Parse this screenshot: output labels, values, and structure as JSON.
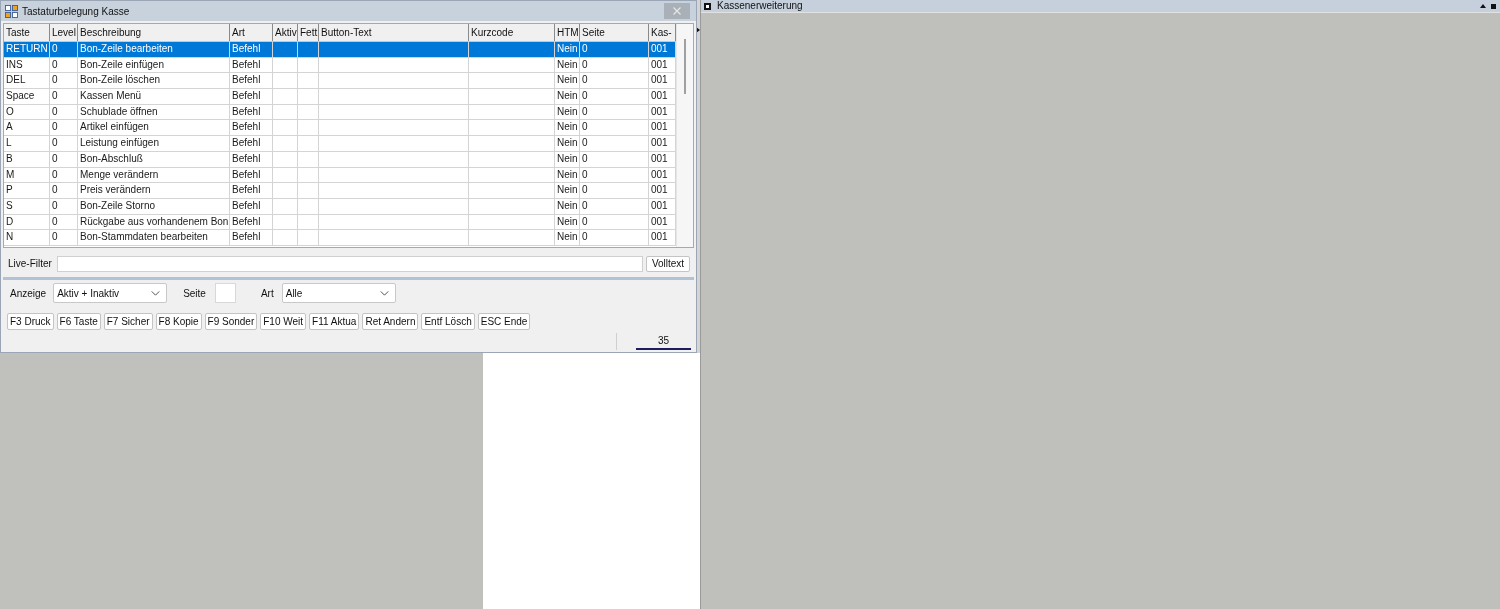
{
  "window": {
    "title": "Tastaturbelegung Kasse"
  },
  "table": {
    "columns": [
      "Taste",
      "Level",
      "Beschreibung",
      "Art",
      "Aktiv",
      "Fett",
      "Button-Text",
      "Kurzcode",
      "HTM",
      "Seite",
      "Kas-"
    ],
    "rows": [
      {
        "selected": true,
        "key": "RETURN",
        "key_level": "0",
        "description": "Bon-Zeile bearbeiten",
        "type": "Befehl",
        "html": "Nein",
        "page": "0",
        "column_11": "001"
      },
      {
        "selected": false,
        "key": "INS",
        "key_level": "0",
        "description": "Bon-Zeile einfügen",
        "type": "Befehl",
        "html": "Nein",
        "page": "0",
        "column_11": "001"
      },
      {
        "selected": false,
        "key": "DEL",
        "key_level": "0",
        "description": "Bon-Zeile löschen",
        "type": "Befehl",
        "html": "Nein",
        "page": "0",
        "column_11": "001"
      },
      {
        "selected": false,
        "key": "Space",
        "key_level": "0",
        "description": "Kassen Menü",
        "type": "Befehl",
        "html": "Nein",
        "page": "0",
        "column_11": "001"
      },
      {
        "selected": false,
        "key": "O",
        "key_level": "0",
        "description": "Schublade öffnen",
        "type": "Befehl",
        "html": "Nein",
        "page": "0",
        "column_11": "001"
      },
      {
        "selected": false,
        "key": "A",
        "key_level": "0",
        "description": "Artikel einfügen",
        "type": "Befehl",
        "html": "Nein",
        "page": "0",
        "column_11": "001"
      },
      {
        "selected": false,
        "key": "L",
        "key_level": "0",
        "description": "Leistung einfügen",
        "type": "Befehl",
        "html": "Nein",
        "page": "0",
        "column_11": "001"
      },
      {
        "selected": false,
        "key": "B",
        "key_level": "0",
        "description": "Bon-Abschluß",
        "type": "Befehl",
        "html": "Nein",
        "page": "0",
        "column_11": "001"
      },
      {
        "selected": false,
        "key": "M",
        "key_level": "0",
        "description": "Menge verändern",
        "type": "Befehl",
        "html": "Nein",
        "page": "0",
        "column_11": "001"
      },
      {
        "selected": false,
        "key": "P",
        "key_level": "0",
        "description": "Preis verändern",
        "type": "Befehl",
        "html": "Nein",
        "page": "0",
        "column_11": "001"
      },
      {
        "selected": false,
        "key": "S",
        "key_level": "0",
        "description": "Bon-Zeile Storno",
        "type": "Befehl",
        "html": "Nein",
        "page": "0",
        "column_11": "001"
      },
      {
        "selected": false,
        "key": "D",
        "key_level": "0",
        "description": "Rückgabe aus vorhandenem Bon",
        "type": "Befehl",
        "html": "Nein",
        "page": "0",
        "column_11": "001"
      },
      {
        "selected": false,
        "key": "N",
        "key_level": "0",
        "description": "Bon-Stammdaten bearbeiten",
        "type": "Befehl",
        "html": "Nein",
        "page": "0",
        "column_11": "001"
      }
    ]
  },
  "live_filter": {
    "label": "Live-Filter",
    "button": "Volltext"
  },
  "options": {
    "display_label": "Anzeige",
    "display_value": "Aktiv + Inaktiv",
    "page_label": "Seite",
    "type_label": "Art",
    "type_value": "Alle"
  },
  "buttons": [
    "F3 Druck",
    "F6 Taste",
    "F7 Sicher",
    "F8 Kopie",
    "F9 Sonder",
    "F10 Weit",
    "F11 Aktua",
    "Ret Andern",
    "Entf Lösch",
    "ESC Ende"
  ],
  "status_bar": {
    "count": "35"
  },
  "side_panel": {
    "title": "Kassenerweiterung"
  }
}
